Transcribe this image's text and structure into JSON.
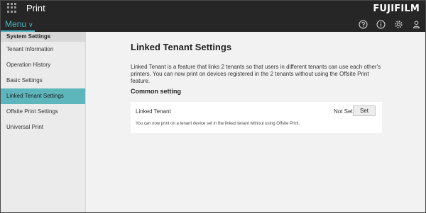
{
  "header": {
    "app_title": "Print",
    "brand": "FUJIFILM",
    "menu_label": "Menu",
    "icons": [
      "apps-grid-icon",
      "help-icon",
      "info-icon",
      "gear-icon",
      "user-icon"
    ]
  },
  "sidebar": {
    "section_title": "System Settings",
    "items": [
      {
        "label": "Tenant Information",
        "active": false
      },
      {
        "label": "Operation History",
        "active": false
      },
      {
        "label": "Basic Settings",
        "active": false
      },
      {
        "label": "Linked Tenant Settings",
        "active": true
      },
      {
        "label": "Offsite Print Settings",
        "active": false
      },
      {
        "label": "Universal Print",
        "active": false
      }
    ]
  },
  "main": {
    "title": "Linked Tenant Settings",
    "description": "Linked Tenant is a feature that links 2 tenants so that users in different tenants can use each other's printers. You can now print on devices registered in the 2 tenants without using the Offsite Print feature.",
    "section_title": "Common setting",
    "setting": {
      "label": "Linked Tenant",
      "status": "Not Set",
      "button_label": "Set",
      "hint": "You can now print on a tenant device set in the linked tenant without using Offsite Print."
    }
  },
  "colors": {
    "topbar": "#262626",
    "accent": "#5eb6bd",
    "menu_accent": "#4fb4c4"
  }
}
